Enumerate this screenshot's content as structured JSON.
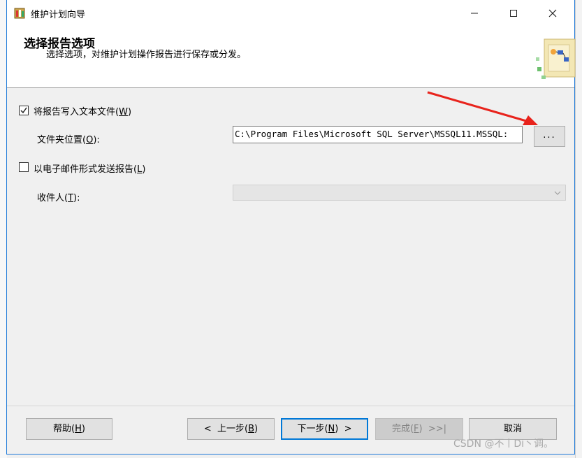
{
  "window": {
    "title": "维护计划向导"
  },
  "header": {
    "title": "选择报告选项",
    "subtitle": "选择选项，对维护计划操作报告进行保存或分发。"
  },
  "options": {
    "write_to_file": {
      "label": "将报告写入文本文件",
      "hotkey": "W",
      "checked": true
    },
    "folder_location": {
      "label": "文件夹位置",
      "hotkey": "O",
      "colon": ":",
      "value": "C:\\Program Files\\Microsoft SQL Server\\MSSQL11.MSSQL:",
      "browse_label": "..."
    },
    "email_report": {
      "label": "以电子邮件形式发送报告",
      "hotkey": "L",
      "checked": false
    },
    "recipient": {
      "label": "收件人",
      "hotkey": "T",
      "colon": ":",
      "value": ""
    }
  },
  "buttons": {
    "help": {
      "label": "帮助",
      "hotkey": "H"
    },
    "back": {
      "label": "上一步",
      "hotkey": "B",
      "arrow": "<"
    },
    "next": {
      "label": "下一步",
      "hotkey": "N",
      "arrow": ">"
    },
    "finish": {
      "label": "完成",
      "hotkey": "F",
      "arrow": ">>|"
    },
    "cancel": {
      "label": "取消"
    }
  },
  "watermark": "CSDN @不丨Di丶调。",
  "colors": {
    "accent": "#0078d7",
    "arrow": "#e8231c",
    "window_border": "#1f7ad9"
  }
}
